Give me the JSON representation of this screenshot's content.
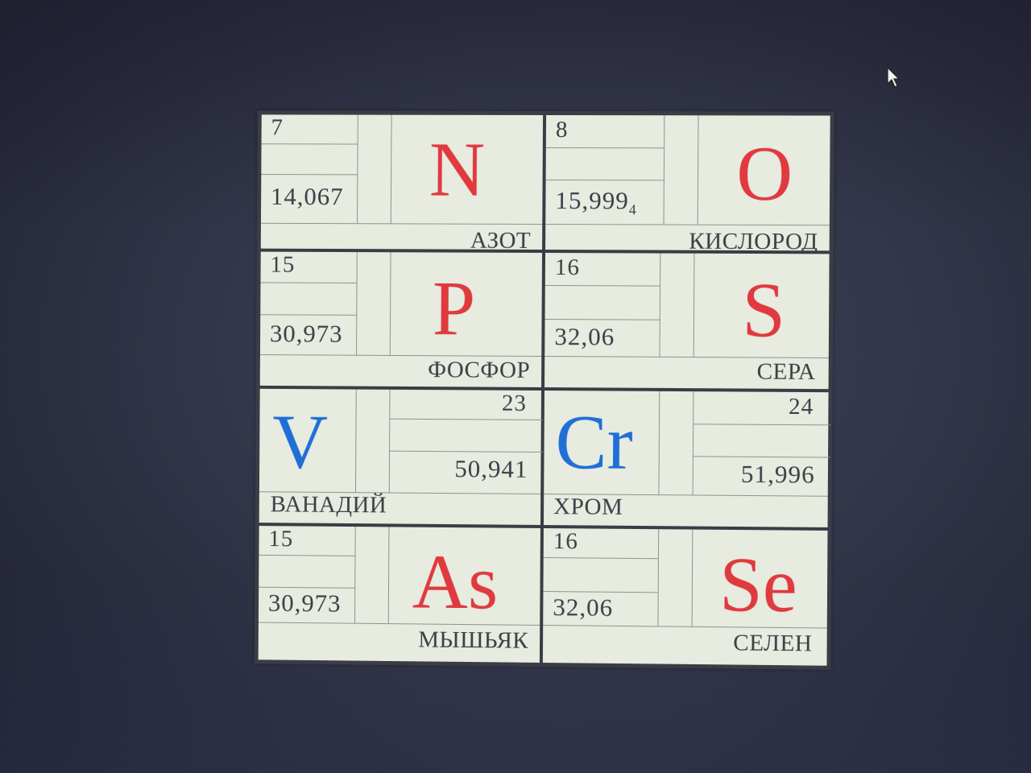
{
  "colors": {
    "p_element": "#e03a3e",
    "d_element": "#1f6fd6",
    "cell_background": "#e7ebe0",
    "border": "#3a3d45",
    "text": "#3b3f46"
  },
  "elements": [
    {
      "number": "7",
      "mass": "14,067",
      "symbol": "N",
      "name": "АЗОТ",
      "color": "red"
    },
    {
      "number": "8",
      "mass": "15,999",
      "mass_sub": "4",
      "symbol": "O",
      "name": "КИСЛОРОД",
      "color": "red"
    },
    {
      "number": "15",
      "mass": "30,973",
      "symbol": "P",
      "name": "ФОСФОР",
      "color": "red"
    },
    {
      "number": "16",
      "mass": "32,06",
      "symbol": "S",
      "name": "СЕРА",
      "color": "red"
    },
    {
      "number": "23",
      "mass": "50,941",
      "symbol": "V",
      "name": "ВАНАДИЙ",
      "color": "blue"
    },
    {
      "number": "24",
      "mass": "51,996",
      "symbol": "Cr",
      "name": "ХРОМ",
      "color": "blue"
    },
    {
      "number": "15",
      "mass": "30,973",
      "symbol": "As",
      "name": "МЫШЬЯК",
      "color": "red"
    },
    {
      "number": "16",
      "mass": "32,06",
      "symbol": "Se",
      "name": "СЕЛЕН",
      "color": "red"
    }
  ]
}
